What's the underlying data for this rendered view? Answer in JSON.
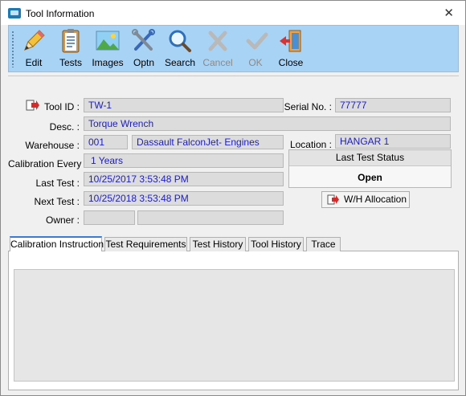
{
  "window": {
    "title": "Tool Information",
    "close_glyph": "✕"
  },
  "toolbar": {
    "items": [
      {
        "label": "Edit",
        "icon": "pencil-icon",
        "enabled": true
      },
      {
        "label": "Tests",
        "icon": "clipboard-icon",
        "enabled": true
      },
      {
        "label": "Images",
        "icon": "image-icon",
        "enabled": true
      },
      {
        "label": "Optn",
        "icon": "tools-icon",
        "enabled": true
      },
      {
        "label": "Search",
        "icon": "magnifier-icon",
        "enabled": true
      },
      {
        "label": "Cancel",
        "icon": "cancel-icon",
        "enabled": false
      },
      {
        "label": "OK",
        "icon": "check-icon",
        "enabled": false
      },
      {
        "label": "Close",
        "icon": "exit-door-icon",
        "enabled": true
      }
    ]
  },
  "form": {
    "tool_id_label": "Tool ID :",
    "tool_id": "TW-1",
    "serial_label": "Serial No. :",
    "serial": "77777",
    "desc_label": "Desc. :",
    "desc": "Torque Wrench",
    "warehouse_label": "Warehouse :",
    "warehouse_code": "001",
    "warehouse_name": "Dassault FalconJet- Engines",
    "location_label": "Location :",
    "location": "HANGAR 1",
    "calibration_label": "Calibration Every :",
    "calibration": "1 Years",
    "last_test_label": "Last Test :",
    "last_test": "10/25/2017 3:53:48 PM",
    "next_test_label": "Next Test :",
    "next_test": "10/25/2018 3:53:48 PM",
    "owner_label": "Owner :",
    "owner_code": "",
    "owner_name": "",
    "status_header": "Last Test Status",
    "status_value": "Open",
    "wh_button": "W/H Allocation"
  },
  "tabs": [
    {
      "label": "Calibration Instruction",
      "active": true
    },
    {
      "label": "Test Requirements",
      "active": false
    },
    {
      "label": "Test History",
      "active": false
    },
    {
      "label": "Tool History",
      "active": false
    },
    {
      "label": "Trace",
      "active": false
    }
  ],
  "colors": {
    "toolbar_bg": "#a9d3f5",
    "field_text": "#1c1cc8",
    "tab_accent": "#3a7bd5"
  }
}
